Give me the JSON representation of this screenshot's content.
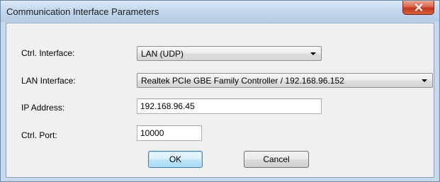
{
  "window": {
    "title": "Communication Interface Parameters"
  },
  "form": {
    "ctrl_interface": {
      "label": "Ctrl. Interface:",
      "value": "LAN (UDP)"
    },
    "lan_interface": {
      "label": "LAN Interface:",
      "value": "Realtek PCIe GBE Family Controller / 192.168.96.152"
    },
    "ip_address": {
      "label": "IP Address:",
      "value": "192.168.96.45"
    },
    "ctrl_port": {
      "label": "Ctrl. Port:",
      "value": "10000"
    }
  },
  "buttons": {
    "ok": "OK",
    "cancel": "Cancel"
  },
  "icons": {
    "close": "close-icon",
    "dropdown": "chevron-down-icon"
  },
  "colors": {
    "close_button": "#c2371c",
    "default_button_border": "#3c7fb1"
  }
}
